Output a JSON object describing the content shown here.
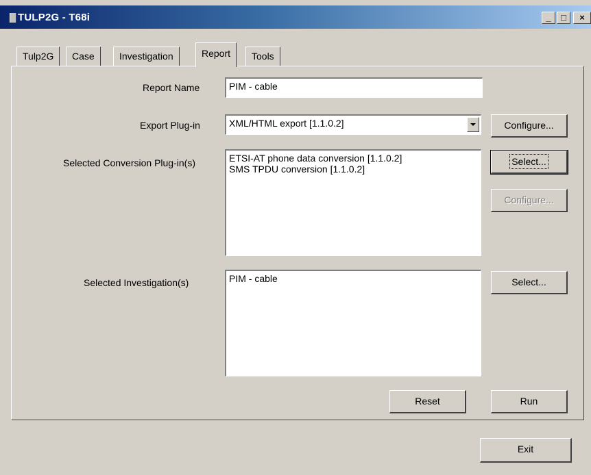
{
  "window": {
    "title": "TULP2G - T68i",
    "controls": {
      "minimize": "_",
      "maximize": "□",
      "close": "×"
    }
  },
  "tabs": [
    {
      "label": "Tulp2G",
      "active": false
    },
    {
      "label": "Case",
      "active": false
    },
    {
      "label": "Investigation",
      "active": false
    },
    {
      "label": "Report",
      "active": true
    },
    {
      "label": "Tools",
      "active": false
    }
  ],
  "report": {
    "name_label": "Report Name",
    "name_value": "PIM - cable",
    "export_label": "Export Plug-in",
    "export_value": "XML/HTML export [1.1.0.2]",
    "export_configure": "Configure...",
    "conversion_label": "Selected Conversion Plug-in(s)",
    "conversion_items": [
      "ETSI-AT phone data conversion [1.1.0.2]",
      "SMS TPDU conversion [1.1.0.2]"
    ],
    "conversion_select": "Select...",
    "conversion_configure": "Configure...",
    "investigation_label": "Selected Investigation(s)",
    "investigation_items": [
      "PIM - cable"
    ],
    "investigation_select": "Select...",
    "reset": "Reset",
    "run": "Run"
  },
  "footer": {
    "exit": "Exit"
  }
}
